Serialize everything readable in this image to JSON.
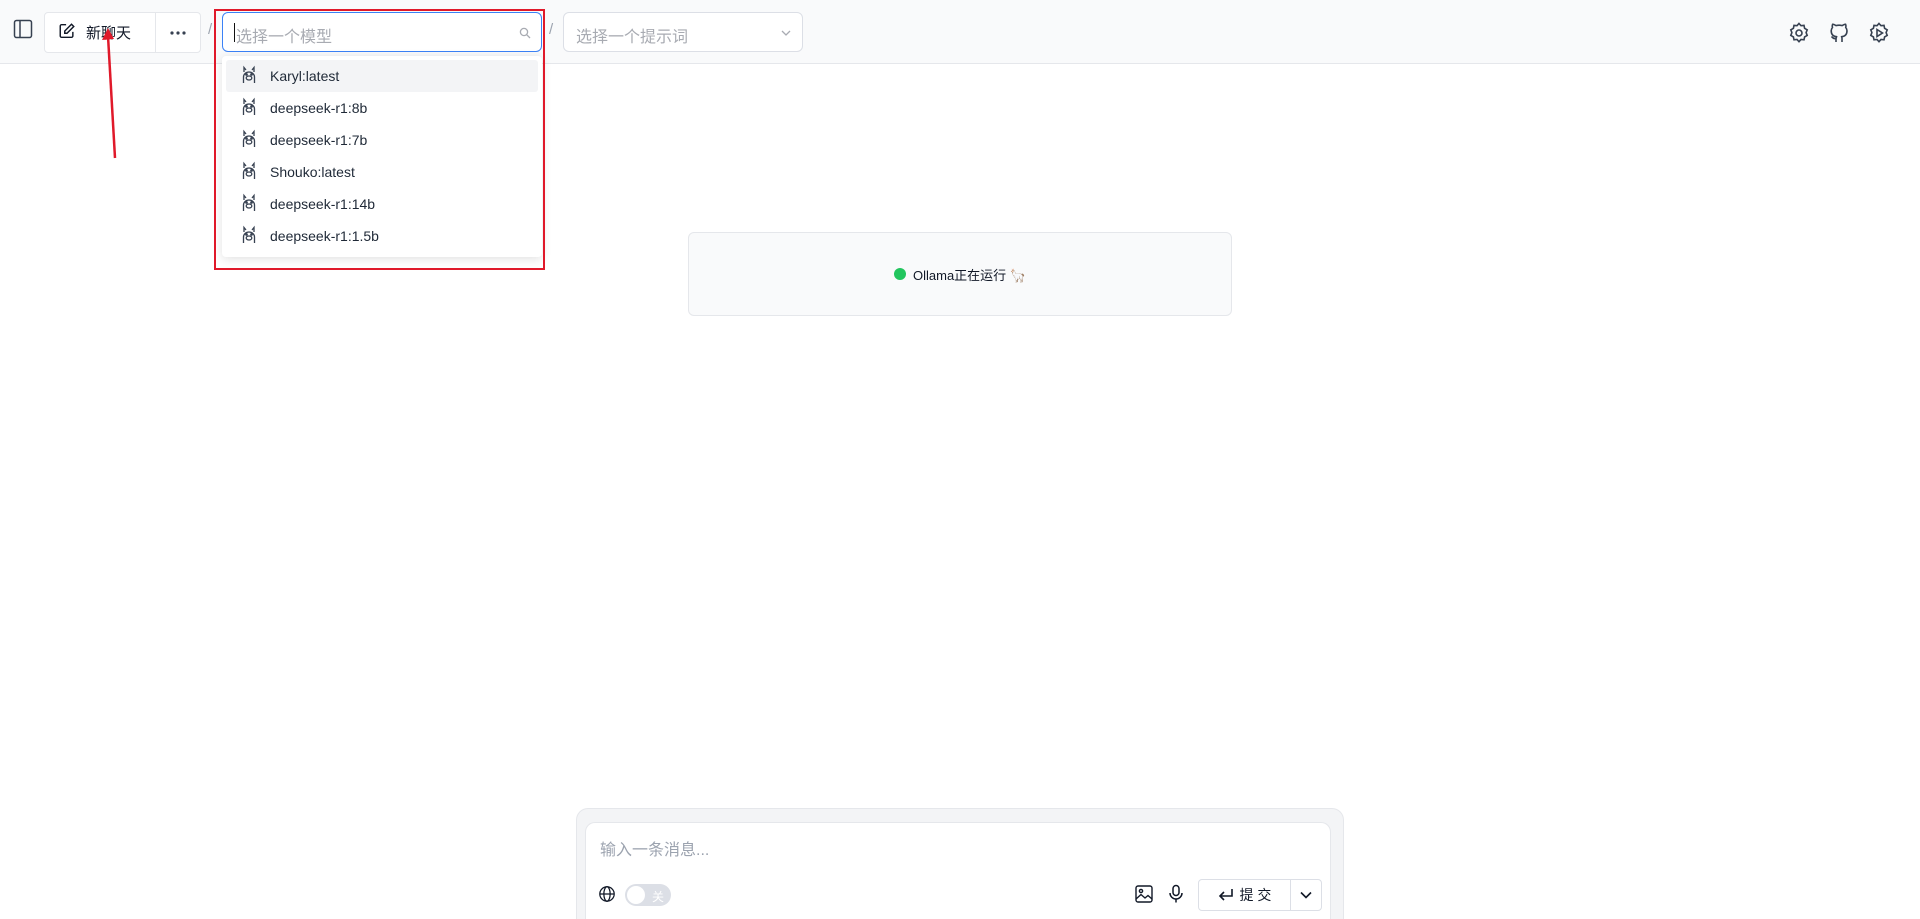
{
  "header": {
    "new_chat_label": "新聊天",
    "model_placeholder": "选择一个模型",
    "prompt_placeholder": "选择一个提示词",
    "separator": "/"
  },
  "model_dropdown": {
    "items": [
      {
        "label": "Karyl:latest",
        "icon": "llama-icon",
        "highlighted": true
      },
      {
        "label": "deepseek-r1:8b",
        "icon": "llama-icon"
      },
      {
        "label": "deepseek-r1:7b",
        "icon": "llama-icon"
      },
      {
        "label": "Shouko:latest",
        "icon": "llama-icon"
      },
      {
        "label": "deepseek-r1:14b",
        "icon": "llama-icon"
      },
      {
        "label": "deepseek-r1:1.5b",
        "icon": "llama-icon"
      }
    ]
  },
  "status": {
    "text": "Ollama正在运行 🦙",
    "color": "#22c55e"
  },
  "composer": {
    "placeholder": "输入一条消息...",
    "web_toggle_label": "关",
    "submit_label": "提 交"
  },
  "colors": {
    "accent": "#3b82f6",
    "annotation": "#e0192a"
  }
}
